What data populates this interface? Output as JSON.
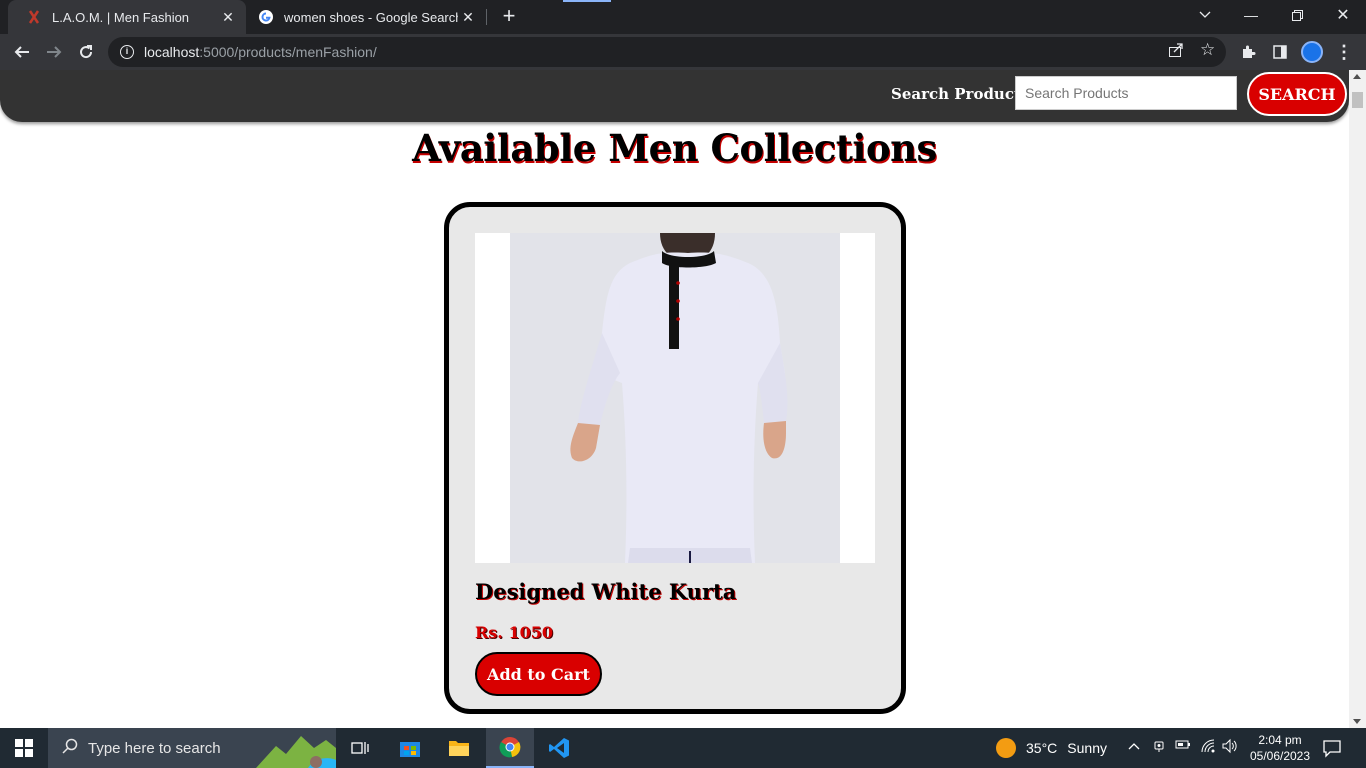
{
  "browser": {
    "tabs": [
      {
        "title": "L.A.O.M. | Men Fashion",
        "active": true
      },
      {
        "title": "women shoes - Google Search",
        "active": false
      }
    ],
    "url_host": "localhost",
    "url_path": ":5000/products/menFashion/"
  },
  "site": {
    "search_label": "Search Product:",
    "search_placeholder": "Search Products",
    "search_button": "SEARCH",
    "heading": "Available Men Collections",
    "accent_color": "#d90000"
  },
  "products": [
    {
      "name": "Designed White Kurta",
      "price": "Rs. 1050",
      "button": "Add to Cart"
    }
  ],
  "taskbar": {
    "search_text": "Type here to search",
    "weather_temp": "35°C",
    "weather_text": "Sunny",
    "time": "2:04 pm",
    "date": "05/06/2023"
  }
}
